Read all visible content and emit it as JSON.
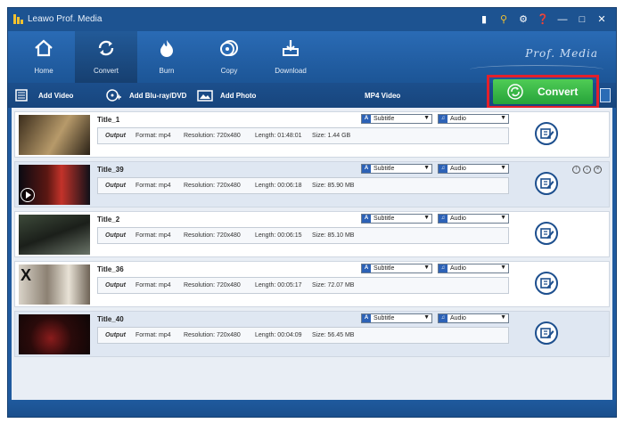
{
  "app": {
    "title": "Leawo Prof. Media",
    "brand": "Prof. Media"
  },
  "titlebar_icons": [
    "feedback-icon",
    "key-icon",
    "settings-icon",
    "help-icon",
    "minimize-icon",
    "maximize-icon",
    "close-icon"
  ],
  "nav": [
    {
      "label": "Home",
      "icon": "home-icon"
    },
    {
      "label": "Convert",
      "icon": "convert-icon",
      "active": true
    },
    {
      "label": "Burn",
      "icon": "burn-icon"
    },
    {
      "label": "Copy",
      "icon": "copy-icon"
    },
    {
      "label": "Download",
      "icon": "download-icon"
    }
  ],
  "toolbar": {
    "add_video": "Add Video",
    "add_bluray": "Add Blu-ray/DVD",
    "add_photo": "Add Photo",
    "profile": "MP4 Video",
    "convert_label": "Convert"
  },
  "labels": {
    "output": "Output",
    "subtitle": "Subtitle",
    "audio": "Audio"
  },
  "items": [
    {
      "title": "Title_1",
      "format": "Format: mp4",
      "resolution": "Resolution: 720x480",
      "length": "Length: 01:48:01",
      "size": "Size: 1.44 GB"
    },
    {
      "title": "Title_39",
      "format": "Format: mp4",
      "resolution": "Resolution: 720x480",
      "length": "Length: 00:06:18",
      "size": "Size: 85.90 MB"
    },
    {
      "title": "Title_2",
      "format": "Format: mp4",
      "resolution": "Resolution: 720x480",
      "length": "Length: 00:06:15",
      "size": "Size: 85.10 MB"
    },
    {
      "title": "Title_36",
      "format": "Format: mp4",
      "resolution": "Resolution: 720x480",
      "length": "Length: 00:05:17",
      "size": "Size: 72.07 MB"
    },
    {
      "title": "Title_40",
      "format": "Format: mp4",
      "resolution": "Resolution: 720x480",
      "length": "Length: 00:04:09",
      "size": "Size: 56.45 MB"
    }
  ],
  "colors": {
    "window": "#1f5a9e",
    "accent_green": "#26a33a",
    "highlight_red": "#e3202b"
  }
}
